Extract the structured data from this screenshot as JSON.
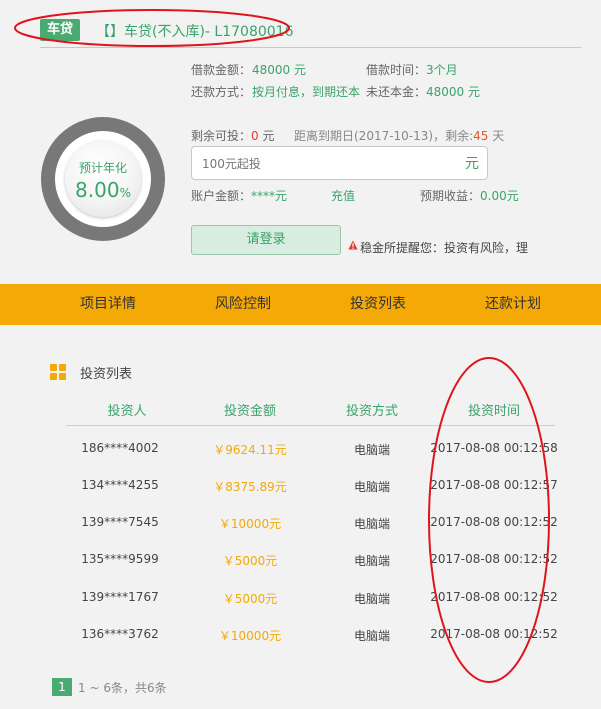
{
  "header": {
    "tag": "车贷",
    "title": "【】车贷(不入库)- L17080016"
  },
  "info": {
    "loan_amount_label": "借款金额：",
    "loan_amount_value": "48000 元",
    "loan_term_label": "借款时间：",
    "loan_term_value": "3个月",
    "repay_label": "还款方式：",
    "repay_value": "按月付息，到期还本",
    "unpaid_label": "未还本金：",
    "unpaid_value": "48000 元",
    "remaining_label": "剩余可投：",
    "remaining_value": "0",
    "remaining_unit": " 元",
    "due_text": "距离到期日(2017-10-13)，剩余:",
    "due_days": "45",
    "due_unit": " 天",
    "rate_label": "预计年化",
    "rate_value": "8.00",
    "rate_unit": "%",
    "amount_placeholder": "100元起投",
    "amount_unit": "元",
    "balance_label": "账户金额：",
    "balance_value": "****元",
    "recharge": "充值",
    "expected_label": "预期收益：",
    "expected_value": "0.00元",
    "login_button": "请登录",
    "risk_text": "稳金所提醒您：投资有风险，理"
  },
  "tabs": [
    "项目详情",
    "风险控制",
    "投资列表",
    "还款计划"
  ],
  "investment_list": {
    "title": "投资列表",
    "headers": [
      "投资人",
      "投资金额",
      "投资方式",
      "投资时间"
    ],
    "rows": [
      {
        "user": "186****4002",
        "amount": "￥9624.11元",
        "method": "电脑端",
        "time": "2017-08-08 00:12:58"
      },
      {
        "user": "134****4255",
        "amount": "￥8375.89元",
        "method": "电脑端",
        "time": "2017-08-08 00:12:57"
      },
      {
        "user": "139****7545",
        "amount": "￥10000元",
        "method": "电脑端",
        "time": "2017-08-08 00:12:52"
      },
      {
        "user": "135****9599",
        "amount": "￥5000元",
        "method": "电脑端",
        "time": "2017-08-08 00:12:52"
      },
      {
        "user": "139****1767",
        "amount": "￥5000元",
        "method": "电脑端",
        "time": "2017-08-08 00:12:52"
      },
      {
        "user": "136****3762",
        "amount": "￥10000元",
        "method": "电脑端",
        "time": "2017-08-08 00:12:52"
      }
    ]
  },
  "pagination": {
    "current": "1",
    "info": "1 ~ 6条，共6条"
  },
  "colors": {
    "brand_green": "#3aa36b",
    "tab_bar": "#f5a906",
    "annotation": "#e0151c"
  }
}
